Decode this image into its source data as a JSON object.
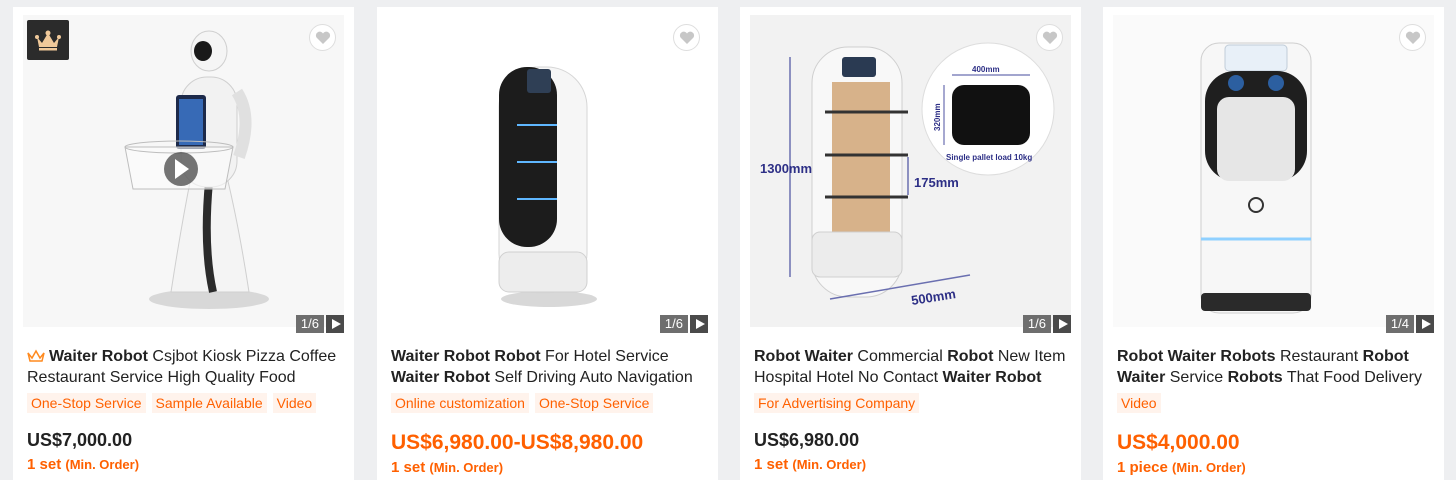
{
  "products": [
    {
      "title_parts": [
        {
          "text": "Waiter Robot",
          "bold": true
        },
        {
          "text": " Csjbot Kiosk Pizza Coffee Restaurant Service High Quality Food",
          "bold": false
        }
      ],
      "tags": [
        "One-Stop Service",
        "Sample Available",
        "Video"
      ],
      "price": "US$7,000.00",
      "moq_qty": "1 set",
      "moq_label": "(Min. Order)",
      "image_counter": "1/6",
      "badge_icon": "crown-icon",
      "favorite_icon": "heart-icon"
    },
    {
      "title_parts": [
        {
          "text": "Waiter Robot Robot",
          "bold": true
        },
        {
          "text": " For Hotel Service ",
          "bold": false
        },
        {
          "text": "Waiter Robot",
          "bold": true
        },
        {
          "text": " Self Driving Auto Navigation",
          "bold": false
        }
      ],
      "tags": [
        "Online customization",
        "One-Stop Service"
      ],
      "price": "US$6,980.00-US$8,980.00",
      "moq_qty": "1 set",
      "moq_label": "(Min. Order)",
      "image_counter": "1/6",
      "favorite_icon": "heart-icon"
    },
    {
      "title_parts": [
        {
          "text": "Robot Waiter",
          "bold": true
        },
        {
          "text": " Commercial ",
          "bold": false
        },
        {
          "text": "Robot",
          "bold": true
        },
        {
          "text": " New Item Hospital Hotel No Contact ",
          "bold": false
        },
        {
          "text": "Waiter Robot",
          "bold": true
        }
      ],
      "tags": [
        "For Advertising Company"
      ],
      "price": "US$6,980.00",
      "moq_qty": "1 set",
      "moq_label": "(Min. Order)",
      "image_counter": "1/6",
      "favorite_icon": "heart-icon",
      "image_annotations": {
        "height": "1300mm",
        "shelf": "175mm",
        "base": "500mm",
        "tray_width": "400mm",
        "tray_depth": "320mm",
        "load": "Single pallet load 10kg"
      }
    },
    {
      "title_parts": [
        {
          "text": "Robot Waiter Robots",
          "bold": true
        },
        {
          "text": " Restaurant ",
          "bold": false
        },
        {
          "text": "Robot Waiter",
          "bold": true
        },
        {
          "text": " Service ",
          "bold": false
        },
        {
          "text": "Robots",
          "bold": true
        },
        {
          "text": " That Food Delivery",
          "bold": false
        }
      ],
      "tags": [
        "Video"
      ],
      "price": "US$4,000.00",
      "moq_qty": "1 piece",
      "moq_label": "(Min. Order)",
      "image_counter": "1/4",
      "favorite_icon": "heart-icon"
    }
  ],
  "colors": {
    "accent": "#ff6000",
    "tag_bg": "#fff3ec",
    "page_bg": "#eeeff1",
    "text": "#222222"
  }
}
